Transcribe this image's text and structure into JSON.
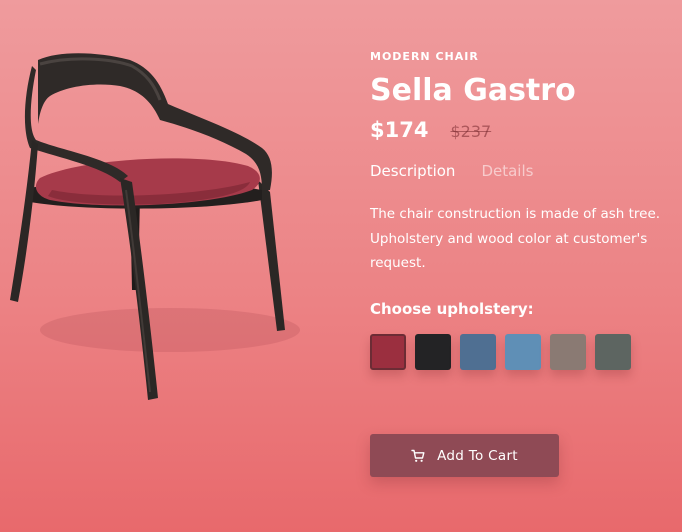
{
  "product": {
    "category": "MODERN CHAIR",
    "name": "Sella Gastro",
    "price": "$174",
    "old_price": "$237"
  },
  "tabs": [
    {
      "label": "Description",
      "active": true
    },
    {
      "label": "Details",
      "active": false
    }
  ],
  "description": "The chair construction is made of ash tree. Upholstery and wood color at customer's request.",
  "upholstery": {
    "label": "Choose upholstery:",
    "swatches": [
      {
        "name": "crimson",
        "color": "#9b2f3f",
        "selected": true
      },
      {
        "name": "black",
        "color": "#232325",
        "selected": false
      },
      {
        "name": "denim",
        "color": "#4f6f92",
        "selected": false
      },
      {
        "name": "light-blue",
        "color": "#5f8fb6",
        "selected": false
      },
      {
        "name": "taupe",
        "color": "#8a7a73",
        "selected": false
      },
      {
        "name": "gray-green",
        "color": "#5d6561",
        "selected": false
      }
    ]
  },
  "cart": {
    "label": "Add To Cart",
    "icon": "shopping-cart-icon"
  },
  "colors": {
    "background": "#ec8385",
    "button": "#8f4a55",
    "chair_frame": "#2b2725",
    "chair_seat": "#a63a4a"
  }
}
